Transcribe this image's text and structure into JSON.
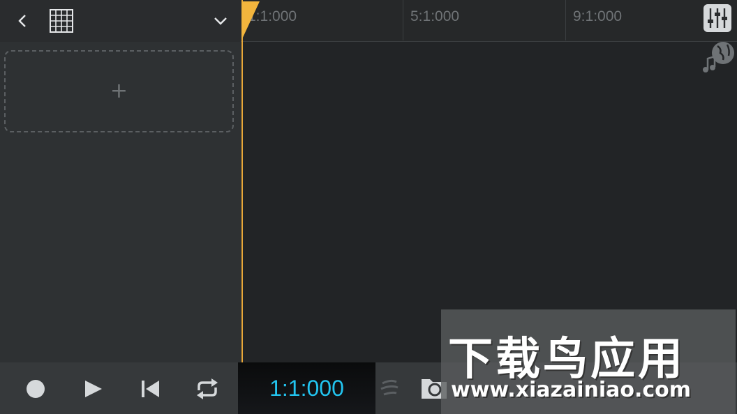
{
  "ruler": {
    "labels": [
      "1:1:000",
      "5:1:000",
      "9:1:000"
    ]
  },
  "add_track": {
    "symbol": "+"
  },
  "transport": {
    "time": "1:1:000"
  },
  "watermark": {
    "title": "下载鸟应用",
    "url": "www.xiazainiao.com"
  },
  "colors": {
    "accent": "#22c4ef",
    "playhead": "#e8a83a"
  }
}
